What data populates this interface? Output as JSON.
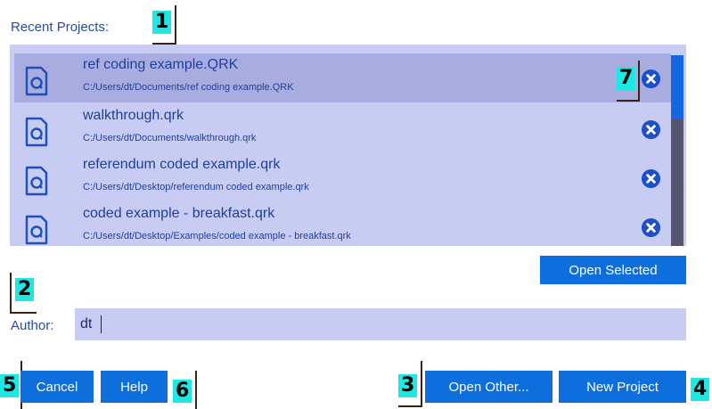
{
  "recent_label": "Recent Projects:",
  "projects": [
    {
      "name": "ref coding example.QRK",
      "path": "C:/Users/dt/Documents/ref coding example.QRK"
    },
    {
      "name": "walkthrough.qrk",
      "path": "C:/Users/dt/Documents/walkthrough.qrk"
    },
    {
      "name": "referendum coded example.qrk",
      "path": "C:/Users/dt/Desktop/referendum coded example.qrk"
    },
    {
      "name": "coded example - breakfast.qrk",
      "path": "C:/Users/dt/Desktop/Examples/coded example - breakfast.qrk"
    }
  ],
  "open_selected_label": "Open Selected",
  "author": {
    "label": "Author:",
    "value": "dt"
  },
  "buttons": {
    "cancel": "Cancel",
    "help": "Help",
    "open_other": "Open Other...",
    "new_project": "New Project"
  },
  "callouts": {
    "c1": "1",
    "c2": "2",
    "c3": "3",
    "c4": "4",
    "c5": "5",
    "c6": "6",
    "c7": "7"
  },
  "colors": {
    "accent": "#0d6edc",
    "panel": "#c9ccf2",
    "selected_row": "#a9acdf",
    "callout": "#1de8e4"
  },
  "icons": {
    "project_file": "document-icon",
    "remove": "remove-circle-icon"
  }
}
